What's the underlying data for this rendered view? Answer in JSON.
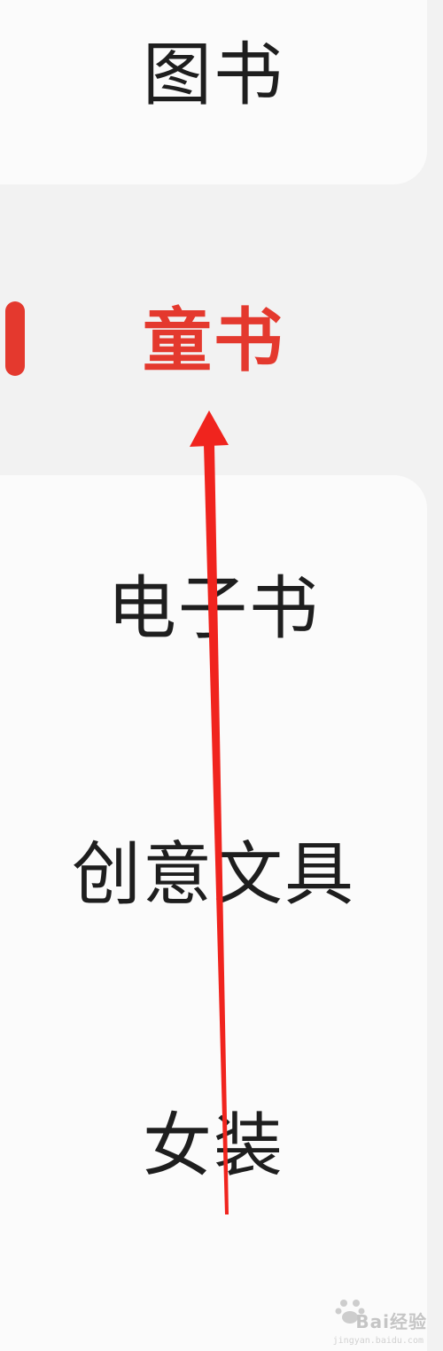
{
  "sidebar": {
    "items": [
      {
        "label": "图书"
      },
      {
        "label": "童书"
      },
      {
        "label": "电子书"
      },
      {
        "label": "创意文具"
      },
      {
        "label": "女装"
      }
    ]
  },
  "colors": {
    "accent": "#e4392e",
    "text": "#1e1e1e",
    "panel": "#fbfbfb",
    "active_background": "#f2f2f2"
  },
  "annotation": {
    "icon": "arrow-up-icon",
    "color": "#f0241e"
  },
  "watermark": {
    "text": "Bai经验",
    "sub": "jingyan.baidu.com"
  }
}
